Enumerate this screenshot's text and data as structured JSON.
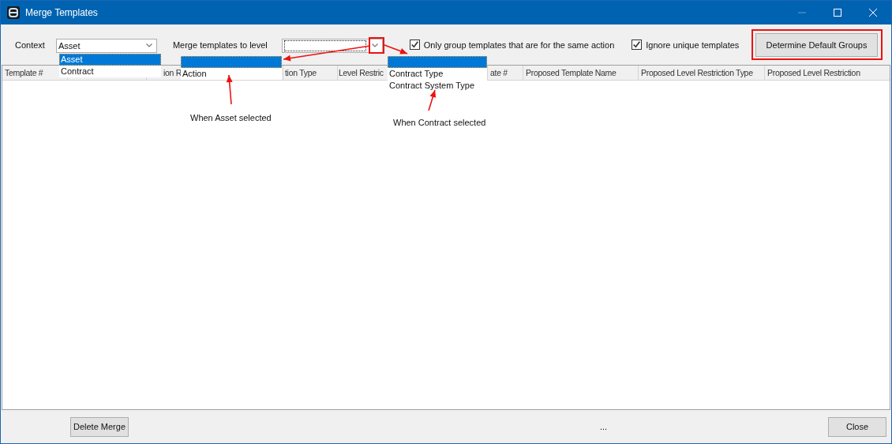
{
  "window": {
    "title": "Merge Templates"
  },
  "toolbar": {
    "context": {
      "label": "Context",
      "value": "Asset"
    },
    "level": {
      "label": "Merge templates to level"
    },
    "checkboxes": [
      {
        "label": "Only group templates that are for the same action",
        "checked": true
      },
      {
        "label": "Ignore unique templates",
        "checked": true
      }
    ],
    "button": "Determine Default Groups"
  },
  "table": {
    "columns": [
      "Template #",
      "ion R",
      "tion Type",
      "Level Restric",
      "ate #",
      "Proposed Template Name",
      "Proposed Level Restriction Type",
      "Proposed Level Restriction"
    ]
  },
  "context_list": [
    {
      "label": "Asset",
      "selected": true
    },
    {
      "label": "Contract",
      "selected": false
    }
  ],
  "asset_level_list": [
    {
      "selected": true
    },
    {
      "label": "Action",
      "selected": false
    }
  ],
  "contract_level_list": [
    {
      "selected": true
    },
    {
      "label": "Contract Type",
      "selected": false
    },
    {
      "label": "Contract System Type",
      "selected": false
    }
  ],
  "annotations": [
    "When Asset selected",
    "When Contract selected"
  ],
  "footer": {
    "delete_button": "Delete Merge",
    "status": "...",
    "close_button": "Close"
  }
}
